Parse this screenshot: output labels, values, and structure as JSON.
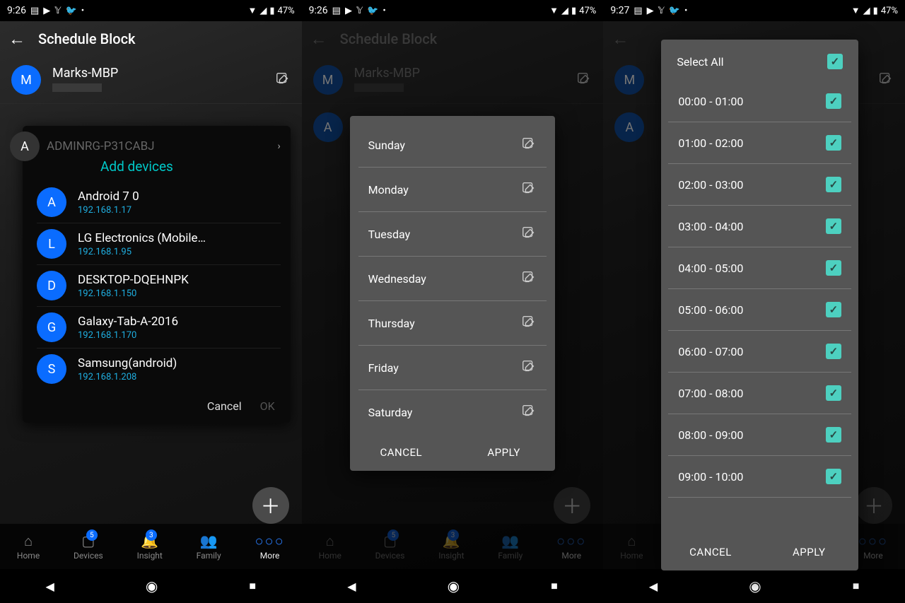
{
  "status": {
    "time_a": "9:26",
    "time_b": "9:27",
    "battery": "47%"
  },
  "header": {
    "title": "Schedule Block"
  },
  "devices": [
    {
      "initial": "M",
      "name": "Marks-MBP"
    },
    {
      "initial": "A",
      "name": "ADMINRG-P31CABJ"
    }
  ],
  "add_dialog": {
    "title": "Add devices",
    "peek_initial": "A",
    "peek_name": "ADMINRG-P31CABJ",
    "items": [
      {
        "initial": "A",
        "name": "Android 7 0",
        "ip": "192.168.1.17"
      },
      {
        "initial": "L",
        "name": "LG Electronics (Mobile…",
        "ip": "192.168.1.95"
      },
      {
        "initial": "D",
        "name": "DESKTOP-DQEHNPK",
        "ip": "192.168.1.150"
      },
      {
        "initial": "G",
        "name": "Galaxy-Tab-A-2016",
        "ip": "192.168.1.170"
      },
      {
        "initial": "S",
        "name": "Samsung(android)",
        "ip": "192.168.1.208"
      }
    ],
    "cancel": "Cancel",
    "ok": "OK"
  },
  "days_dialog": {
    "days": [
      "Sunday",
      "Monday",
      "Tuesday",
      "Wednesday",
      "Thursday",
      "Friday",
      "Saturday"
    ],
    "cancel": "CANCEL",
    "apply": "APPLY"
  },
  "hours_dialog": {
    "select_all": "Select All",
    "slots": [
      "00:00 - 01:00",
      "01:00 - 02:00",
      "02:00 - 03:00",
      "03:00 - 04:00",
      "04:00 - 05:00",
      "05:00 - 06:00",
      "06:00 - 07:00",
      "07:00 - 08:00",
      "08:00 - 09:00",
      "09:00 - 10:00"
    ],
    "cancel": "CANCEL",
    "apply": "APPLY"
  },
  "nav": {
    "items": [
      {
        "label": "Home"
      },
      {
        "label": "Devices",
        "badge": "5"
      },
      {
        "label": "Insight",
        "badge": "3"
      },
      {
        "label": "Family"
      },
      {
        "label": "More"
      }
    ]
  }
}
